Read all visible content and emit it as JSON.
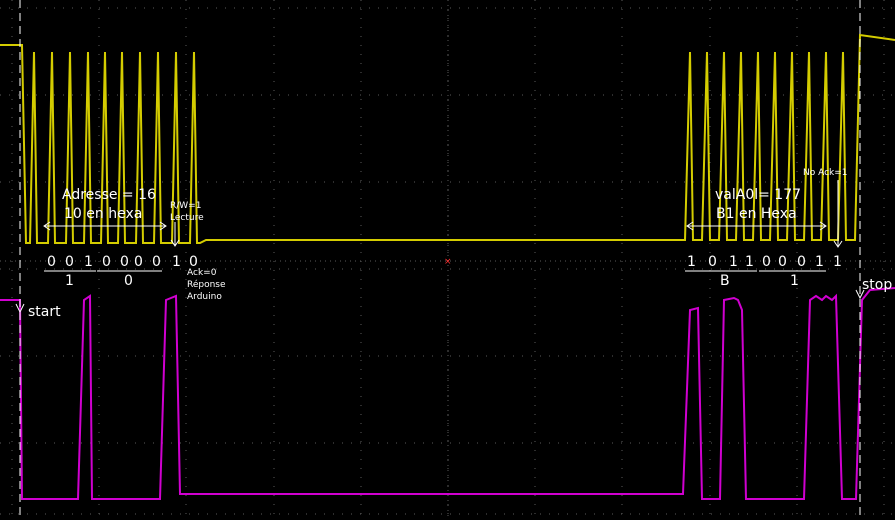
{
  "colors": {
    "background": "#000000",
    "grid": "#5a5a5a",
    "channel1": "#d4cc00",
    "channel2": "#d000d0",
    "marker": "#ffffff",
    "center": "#ff3030"
  },
  "annotations": {
    "address_title": "Adresse = 16",
    "address_hex": "10 en hexa",
    "rw": "R/W=1",
    "rw_mode": "Lecture",
    "ack_line1": "Ack=0",
    "ack_line2": "Réponse",
    "ack_line3": "Arduino",
    "no_ack": "No Ack=1",
    "value_title": "valA0l= 177",
    "value_hex": "B1 en Hexa",
    "start": "start",
    "stop": "stop"
  },
  "address_bits": {
    "nibble1": [
      "0",
      "0",
      "1"
    ],
    "nibble2": [
      "0",
      "0",
      "0",
      "0"
    ],
    "rw_bit": "1",
    "ack_bit": "0",
    "hex1": "1",
    "hex2": "0"
  },
  "value_bits": {
    "nibble1": [
      "1",
      "0",
      "1",
      "1"
    ],
    "nibble2": [
      "0",
      "0",
      "0",
      "1"
    ],
    "nack_bit": "1",
    "hex1": "B",
    "hex2": "1"
  }
}
